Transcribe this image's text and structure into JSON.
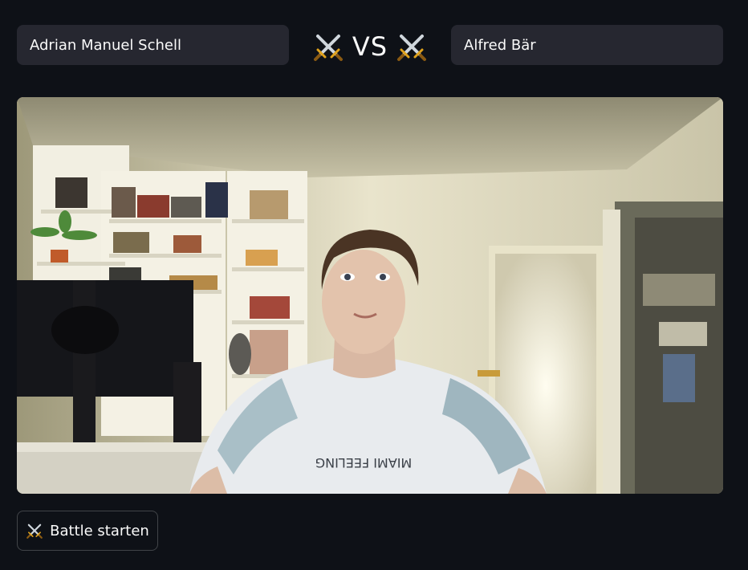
{
  "players": {
    "player1_value": "Adrian Manuel Schell",
    "player2_value": "Alfred Bär"
  },
  "versus": {
    "text": "VS",
    "icon": "crossed-swords-icon"
  },
  "camera": {
    "description_icon": "webcam-snapshot"
  },
  "actions": {
    "battle_label": "Battle starten",
    "battle_icon": "crossed-swords-icon"
  },
  "colors": {
    "background": "#0e1117",
    "input_bg": "#262730",
    "text": "#fafafa"
  }
}
